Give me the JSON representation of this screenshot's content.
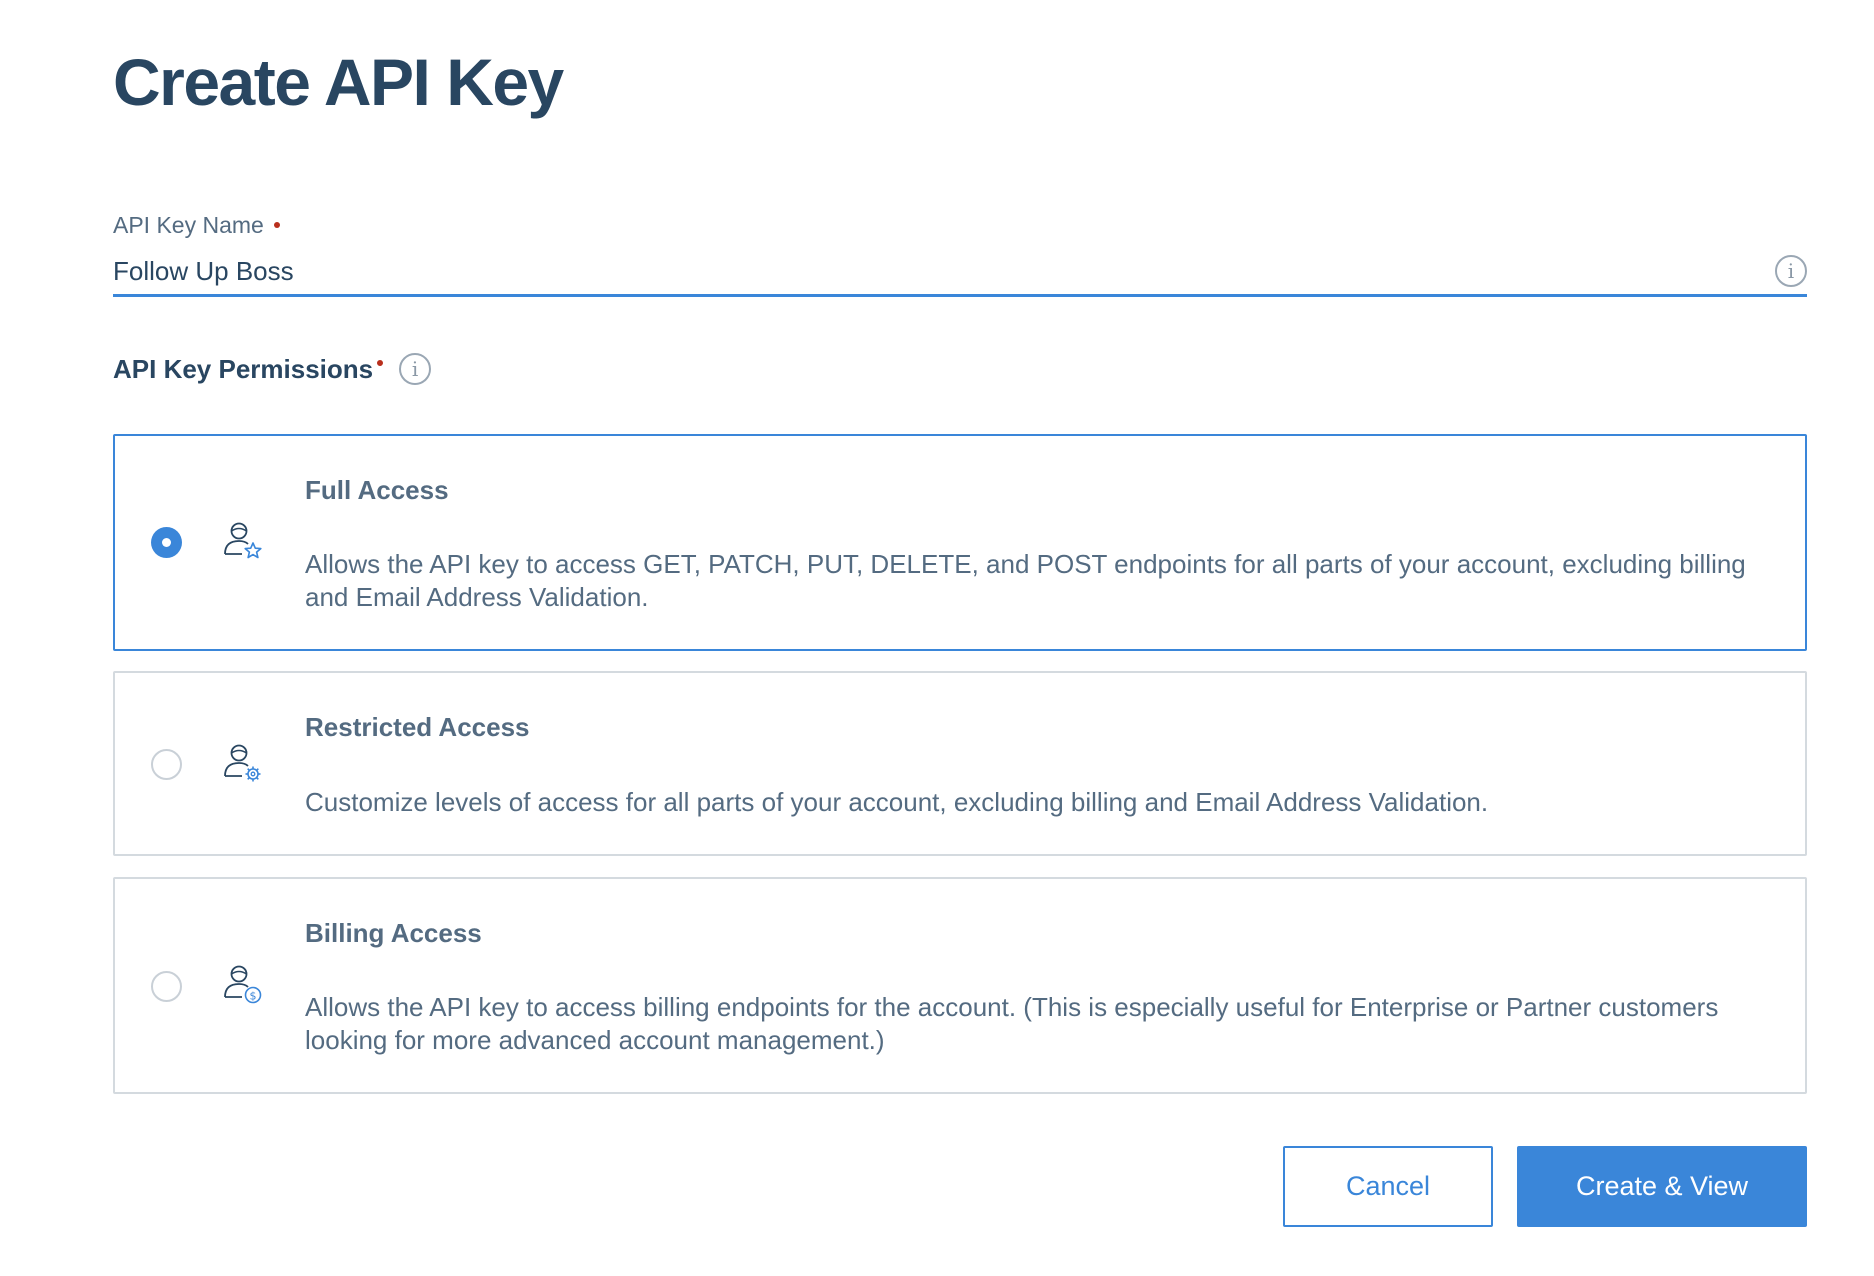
{
  "page": {
    "title": "Create API Key"
  },
  "name_field": {
    "label": "API Key Name",
    "value": "Follow Up Boss",
    "info_icon": "info-icon"
  },
  "permissions": {
    "heading": "API Key Permissions",
    "info_icon": "info-icon",
    "options": [
      {
        "title": "Full Access",
        "description": "Allows the API key to access GET, PATCH, PUT, DELETE, and POST endpoints for all parts of your account, excluding billing and Email Address Validation.",
        "icon": "user-star-icon",
        "selected": true
      },
      {
        "title": "Restricted Access",
        "description": "Customize levels of access for all parts of your account, excluding billing and Email Address Validation.",
        "icon": "user-gear-icon",
        "selected": false
      },
      {
        "title": "Billing Access",
        "description": "Allows the API key to access billing endpoints for the account. (This is especially useful for Enterprise or Partner customers looking for more advanced account management.)",
        "icon": "user-dollar-icon",
        "selected": false
      }
    ]
  },
  "actions": {
    "cancel_label": "Cancel",
    "create_label": "Create & View"
  },
  "colors": {
    "accent": "#3a86d9",
    "heading": "#294661",
    "body_text": "#546b81",
    "required": "#b92f1c",
    "border": "#d4dadf"
  }
}
